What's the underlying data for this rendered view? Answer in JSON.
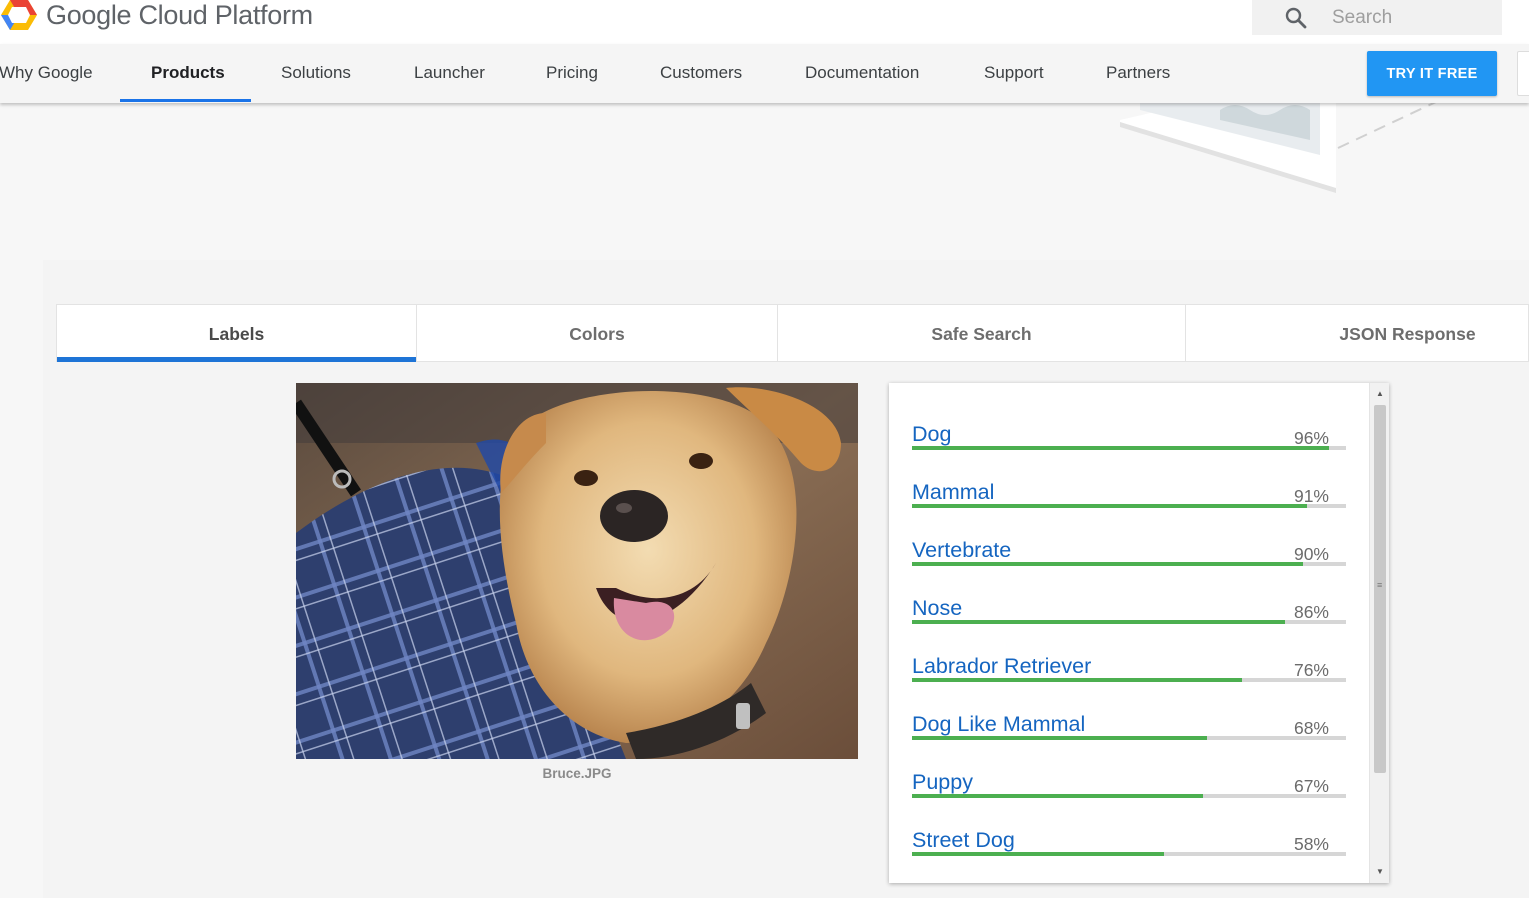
{
  "header": {
    "brand": "Google Cloud Platform",
    "search_placeholder": "Search"
  },
  "nav": {
    "items": [
      "Why Google",
      "Products",
      "Solutions",
      "Launcher",
      "Pricing",
      "Customers",
      "Documentation",
      "Support",
      "Partners"
    ],
    "active": "Products",
    "cta": "TRY IT FREE"
  },
  "tabs": {
    "items": [
      "Labels",
      "Colors",
      "Safe Search",
      "JSON Response"
    ],
    "active": "Labels"
  },
  "image": {
    "caption": "Bruce.JPG"
  },
  "labels": [
    {
      "name": "Dog",
      "score": "96%",
      "value": 0.96
    },
    {
      "name": "Mammal",
      "score": "91%",
      "value": 0.91
    },
    {
      "name": "Vertebrate",
      "score": "90%",
      "value": 0.9
    },
    {
      "name": "Nose",
      "score": "86%",
      "value": 0.86
    },
    {
      "name": "Labrador Retriever",
      "score": "76%",
      "value": 0.76
    },
    {
      "name": "Dog Like Mammal",
      "score": "68%",
      "value": 0.68
    },
    {
      "name": "Puppy",
      "score": "67%",
      "value": 0.67
    },
    {
      "name": "Street Dog",
      "score": "58%",
      "value": 0.58
    }
  ],
  "colors": {
    "accent": "#2196f3",
    "tab_indicator": "#1e74d6",
    "label_text": "#1565c0",
    "bar_fill": "#4caf50"
  }
}
